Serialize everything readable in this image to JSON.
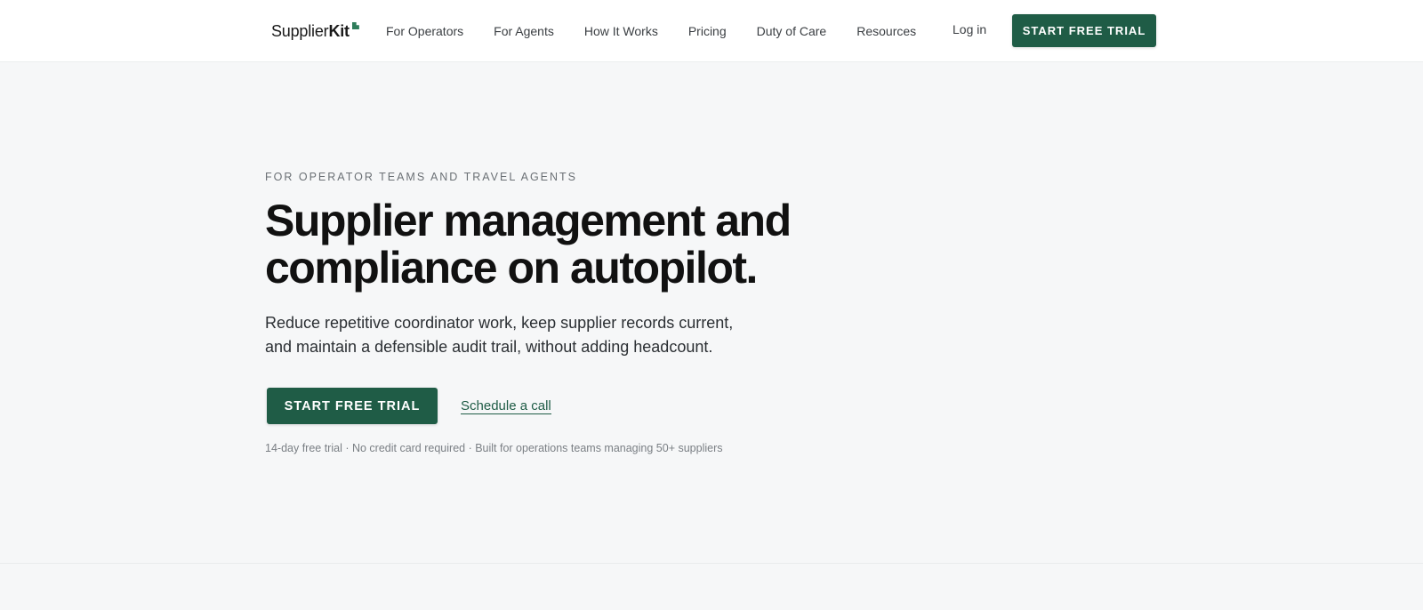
{
  "header": {
    "logo": {
      "text_regular": "Supplier",
      "text_bold": "Kit",
      "mark_icon": "corner-square-icon"
    },
    "nav": [
      {
        "label": "For Operators"
      },
      {
        "label": "For Agents"
      },
      {
        "label": "How It Works"
      },
      {
        "label": "Pricing"
      },
      {
        "label": "Duty of Care"
      },
      {
        "label": "Resources"
      }
    ],
    "login_label": "Log in",
    "cta_label": "START FREE TRIAL"
  },
  "hero": {
    "eyebrow": "FOR OPERATOR TEAMS AND TRAVEL AGENTS",
    "headline": "Supplier management and compliance on autopilot.",
    "subtext": "Reduce repetitive coordinator work, keep supplier records current, and maintain a defensible audit trail, without adding headcount.",
    "primary_cta": "START FREE TRIAL",
    "secondary_cta": "Schedule a call",
    "fineprint": "14-day free trial · No credit card required · Built for operations teams managing 50+ suppliers"
  },
  "colors": {
    "brand_green": "#1f5c46",
    "logo_green": "#2e7d5b",
    "page_bg": "#f6f7f8",
    "header_bg": "#ffffff"
  }
}
